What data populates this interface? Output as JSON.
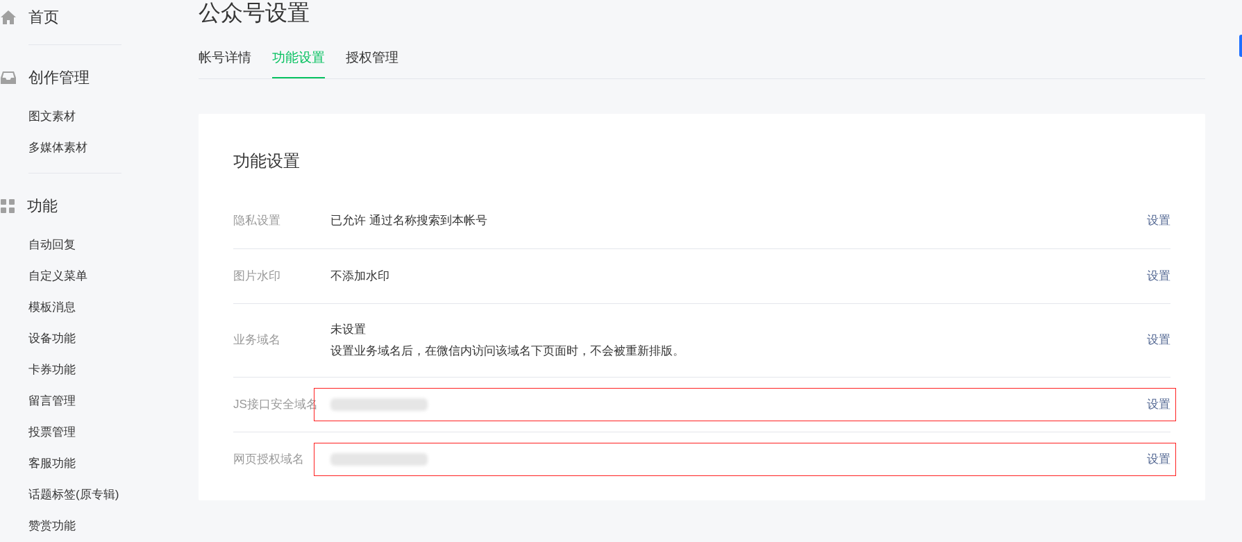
{
  "sidebar": {
    "groups": [
      {
        "title": "首页"
      },
      {
        "title": "创作管理",
        "items": [
          "图文素材",
          "多媒体素材"
        ]
      },
      {
        "title": "功能",
        "items": [
          "自动回复",
          "自定义菜单",
          "模板消息",
          "设备功能",
          "卡券功能",
          "留言管理",
          "投票管理",
          "客服功能",
          "话题标签(原专辑)",
          "赞赏功能"
        ]
      }
    ]
  },
  "page_title": "公众号设置",
  "tabs": [
    {
      "label": "帐号详情",
      "selected": false
    },
    {
      "label": "功能设置",
      "selected": true
    },
    {
      "label": "授权管理",
      "selected": false
    }
  ],
  "card": {
    "title": "功能设置",
    "rows": [
      {
        "kind": "text",
        "label": "隐私设置",
        "lines": [
          "已允许 通过名称搜索到本帐号"
        ],
        "action": "设置",
        "annotated": false
      },
      {
        "kind": "text",
        "label": "图片水印",
        "lines": [
          "不添加水印"
        ],
        "action": "设置",
        "annotated": false
      },
      {
        "kind": "text",
        "label": "业务域名",
        "lines": [
          "未设置",
          "设置业务域名后，在微信内访问该域名下页面时，不会被重新排版。"
        ],
        "action": "设置",
        "annotated": false
      },
      {
        "kind": "redacted",
        "label": "JS接口安全域名",
        "lines": [],
        "action": "设置",
        "annotated": true
      },
      {
        "kind": "redacted",
        "label": "网页授权域名",
        "lines": [],
        "action": "设置",
        "annotated": true
      }
    ]
  }
}
